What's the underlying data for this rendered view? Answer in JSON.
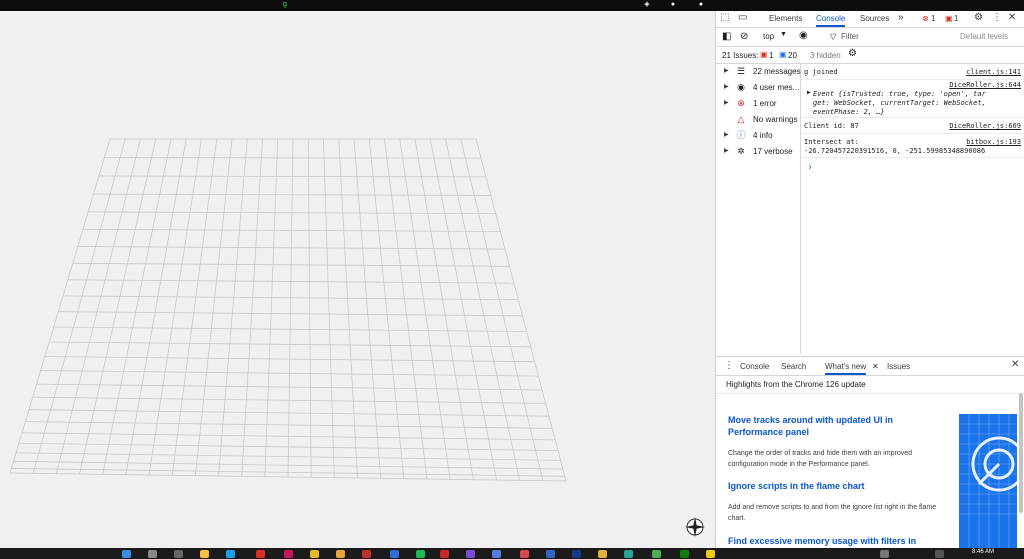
{
  "topbar": {
    "game_label": "g"
  },
  "devtools": {
    "tabs": [
      "Elements",
      "Console",
      "Sources"
    ],
    "more_tabs": "»",
    "error_count": "1",
    "issue_count": "1",
    "toolbar": {
      "context": "top",
      "filter_placeholder": "Filter",
      "levels": "Default levels"
    },
    "issues": {
      "label": "21 Issues:",
      "errors": "1",
      "infos": "20",
      "hidden": "3 hidden"
    },
    "sidebar": [
      {
        "label": "22 messages",
        "icon": "list-icon"
      },
      {
        "label": "4 user mes...",
        "icon": "user-icon"
      },
      {
        "label": "1 error",
        "icon": "error-icon"
      },
      {
        "label": "No warnings",
        "icon": "warning-icon"
      },
      {
        "label": "4 info",
        "icon": "info-icon"
      },
      {
        "label": "17 verbose",
        "icon": "bug-icon"
      }
    ],
    "console": [
      {
        "text": "g joined",
        "source": "client.js:141"
      },
      {
        "source": "DiceRoller.js:644",
        "lines": [
          "Event {isTrusted: true, type: 'open', tar",
          "get: WebSocket, currentTarget: WebSocket,",
          "eventPhase: 2, …}"
        ]
      },
      {
        "text": "Client id: 87",
        "source": "DiceRoller.js:669"
      },
      {
        "text": "Intersect at:",
        "source": "bitbox.js:193",
        "line2": "-26.720457220391516, 0, -251.59985348890086"
      }
    ],
    "prompt": "›",
    "drawer": {
      "tabs": [
        "Console",
        "Search",
        "What's new",
        "Issues"
      ],
      "highlights": "Highlights from the Chrome 126 update",
      "articles": [
        {
          "title": "Move tracks around with updated UI in Performance panel",
          "body": "Change the order of tracks and hide them with an improved configuration mode in the Performance panel."
        },
        {
          "title": "Ignore scripts in the flame chart",
          "body": "Add and remove scripts to and from the ignore list right in the flame chart."
        },
        {
          "title": "Find excessive memory usage with filters in",
          "body": ""
        }
      ]
    }
  },
  "taskbar": {
    "time": "8:46 AM"
  },
  "colors": {
    "accent": "#0b57d0",
    "grid_line": "#c8c8c8",
    "viewport_bg": "#f0f0f0"
  }
}
